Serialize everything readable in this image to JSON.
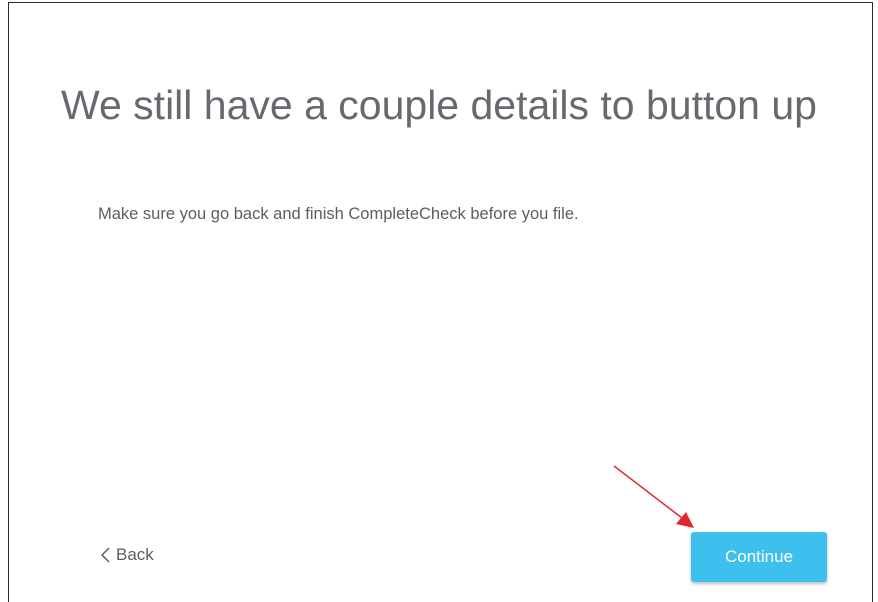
{
  "dialog": {
    "heading": "We still have a couple details to button up",
    "message": "Make sure you go back and finish CompleteCheck before you file."
  },
  "footer": {
    "back_label": "Back",
    "continue_label": "Continue"
  },
  "colors": {
    "continue_button": "#3ec0ef",
    "annotation_arrow": "#e0272c",
    "heading_text": "#666a6e"
  },
  "icons": {
    "back": "chevron-left-icon",
    "annotation": "red-arrow-icon"
  }
}
